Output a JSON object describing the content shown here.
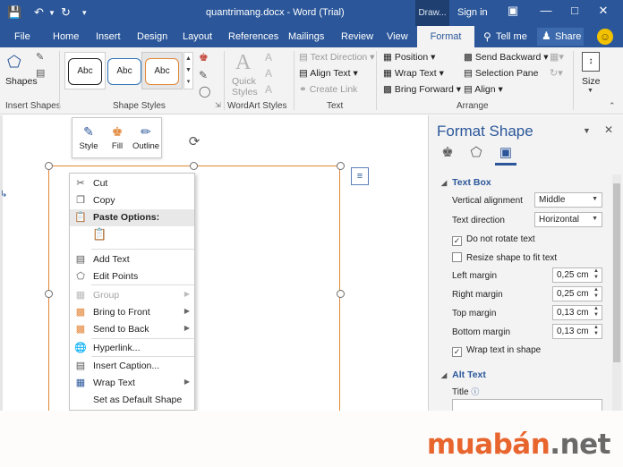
{
  "window": {
    "doc_title": "quantrimang.docx - Word (Trial)",
    "draw_tools": "Draw...",
    "sign_in": "Sign in"
  },
  "tabs": [
    "File",
    "Home",
    "Insert",
    "Design",
    "Layout",
    "References",
    "Mailings",
    "Review",
    "View",
    "Format"
  ],
  "tell_me": "Tell me",
  "share": "Share",
  "ribbon": {
    "shapes_label": "Shapes",
    "insert_shapes": "Insert Shapes",
    "style_abc": "Abc",
    "shape_styles": "Shape Styles",
    "quick_styles": "Quick Styles",
    "wordart_styles": "WordArt Styles",
    "text_direction": "Text Direction",
    "align_text": "Align Text",
    "create_link": "Create Link",
    "text_group": "Text",
    "position": "Position",
    "wrap_text": "Wrap Text",
    "bring_forward": "Bring Forward",
    "send_backward": "Send Backward",
    "selection_pane": "Selection Pane",
    "align": "Align",
    "arrange": "Arrange",
    "size": "Size"
  },
  "mini_toolbar": {
    "style": "Style",
    "fill": "Fill",
    "outline": "Outline"
  },
  "context_menu": {
    "cut": "Cut",
    "copy": "Copy",
    "paste_options": "Paste Options:",
    "add_text": "Add Text",
    "edit_points": "Edit Points",
    "group": "Group",
    "bring_to_front": "Bring to Front",
    "send_to_back": "Send to Back",
    "hyperlink": "Hyperlink...",
    "insert_caption": "Insert Caption...",
    "wrap_text": "Wrap Text",
    "set_default": "Set as Default Shape"
  },
  "pane": {
    "title": "Format Shape",
    "text_box": "Text Box",
    "vertical_alignment": "Vertical alignment",
    "vertical_alignment_value": "Middle",
    "text_direction": "Text direction",
    "text_direction_value": "Horizontal",
    "do_not_rotate": "Do not rotate text",
    "resize_shape": "Resize shape to fit text",
    "left_margin": "Left margin",
    "left_margin_value": "0,25 cm",
    "right_margin": "Right margin",
    "right_margin_value": "0,25 cm",
    "top_margin": "Top margin",
    "top_margin_value": "0,13 cm",
    "bottom_margin": "Bottom margin",
    "bottom_margin_value": "0,13 cm",
    "wrap_text_in_shape": "Wrap text in shape",
    "alt_text": "Alt Text",
    "title_label": "Title"
  },
  "checks": {
    "do_not_rotate": true,
    "resize_shape": false,
    "wrap_text_in_shape": true
  },
  "watermark": {
    "part1": "muabán",
    "part2": ".net"
  },
  "colors": {
    "accent": "#2b579a",
    "shape_border": "#e2873a",
    "brand_orange": "#e8652e"
  }
}
